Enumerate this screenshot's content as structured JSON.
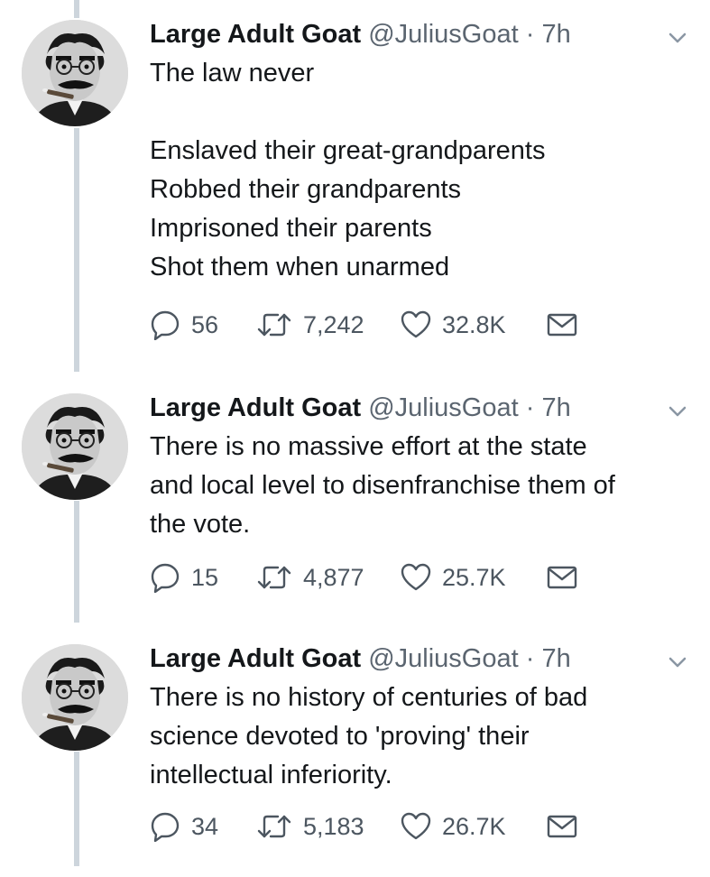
{
  "tweets": [
    {
      "display_name": "Large Adult Goat",
      "handle": "@JuliusGoat",
      "separator": "·",
      "time": "7h",
      "text": "The law never\n\nEnslaved their great-grandparents\nRobbed their grandparents\nImprisoned their parents\nShot them when unarmed",
      "replies": "56",
      "retweets": "7,242",
      "likes": "32.8K"
    },
    {
      "display_name": "Large Adult Goat",
      "handle": "@JuliusGoat",
      "separator": "·",
      "time": "7h",
      "text": "There is no massive effort at the state\nand local level to disenfranchise them of\nthe vote.",
      "replies": "15",
      "retweets": "4,877",
      "likes": "25.7K"
    },
    {
      "display_name": "Large Adult Goat",
      "handle": "@JuliusGoat",
      "separator": "·",
      "time": "7h",
      "text": "There is no history of centuries of bad\nscience devoted to 'proving' their\nintellectual inferiority.",
      "replies": "34",
      "retweets": "5,183",
      "likes": "26.7K"
    }
  ],
  "icons": {
    "reply": "reply-icon",
    "retweet": "retweet-icon",
    "like": "heart-icon",
    "dm": "mail-icon",
    "more": "chevron-down-icon"
  }
}
